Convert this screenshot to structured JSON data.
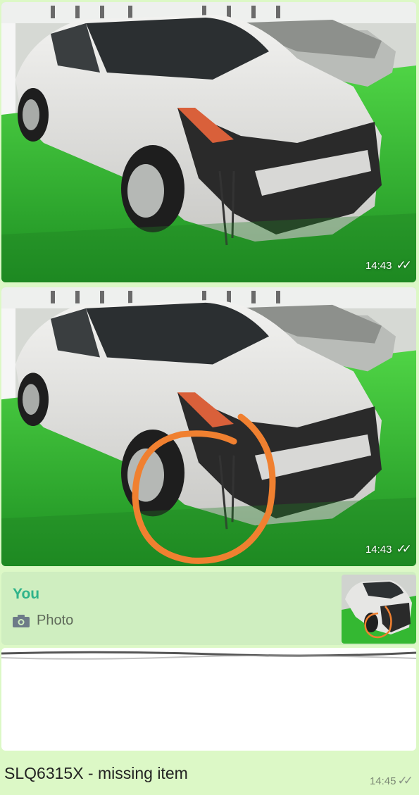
{
  "messages": [
    {
      "type": "photo",
      "time": "14:43",
      "ticks": "✓✓"
    },
    {
      "type": "photo",
      "time": "14:43",
      "ticks": "✓✓"
    }
  ],
  "reply": {
    "author": "You",
    "media_label": "Photo",
    "icon": "camera-icon"
  },
  "text_message": {
    "text": "SLQ6315X - missing item",
    "time": "14:45",
    "ticks": "✓✓"
  },
  "colors": {
    "chat_bg": "#dcf8c6",
    "author": "#2fb38a",
    "floor": "#3ec43a",
    "annotation": "#f08030"
  }
}
